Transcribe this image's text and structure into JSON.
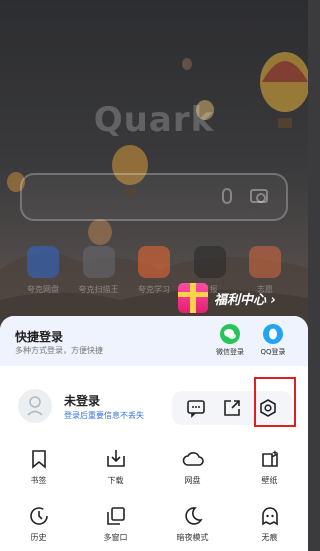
{
  "background": {
    "logo_text": "Quark",
    "shortcuts": [
      {
        "label": "夸克网盘",
        "color": "#2b6be0"
      },
      {
        "label": "夸克扫描王",
        "color": "#6a6e75"
      },
      {
        "label": "夸克学习",
        "color": "#ff6b2e"
      },
      {
        "label": "日报",
        "color": "#2a2a2a"
      },
      {
        "label": "志愿",
        "color": "#e36a3e"
      }
    ]
  },
  "welfare": {
    "label": "福利中心 ›"
  },
  "quick_login": {
    "title": "快捷登录",
    "subtitle": "多种方式登录，方便快捷",
    "options": [
      {
        "label": "微信登录",
        "icon": "wechat-icon"
      },
      {
        "label": "QQ登录",
        "icon": "qq-icon"
      }
    ]
  },
  "user": {
    "name": "未登录",
    "hint": "登录后重要信息不丢失"
  },
  "tools": [
    {
      "icon": "message-icon"
    },
    {
      "icon": "share-icon"
    },
    {
      "icon": "settings-icon"
    }
  ],
  "menu": [
    {
      "label": "书签",
      "icon": "bookmark-icon"
    },
    {
      "label": "下载",
      "icon": "download-icon"
    },
    {
      "label": "网盘",
      "icon": "cloud-icon"
    },
    {
      "label": "壁纸",
      "icon": "wallpaper-icon"
    },
    {
      "label": "历史",
      "icon": "history-icon"
    },
    {
      "label": "多窗口",
      "icon": "multi-window-icon"
    },
    {
      "label": "暗夜模式",
      "icon": "dark-mode-icon"
    },
    {
      "label": "无痕",
      "icon": "incognito-icon"
    }
  ],
  "colors": {
    "accent_blue": "#3470e3",
    "highlight_red": "#e02020"
  }
}
